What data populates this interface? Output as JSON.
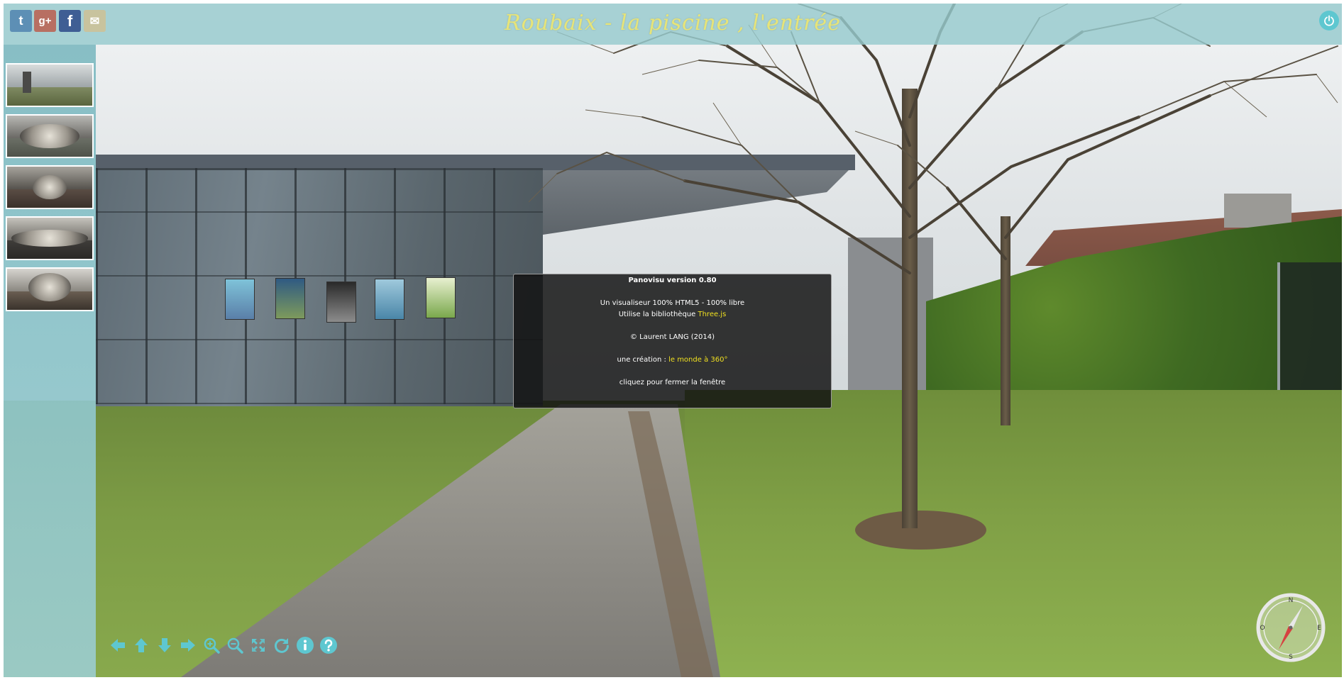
{
  "title": "Roubaix - la piscine , l'entrée",
  "social": {
    "twitter": {
      "icon": "twitter-icon",
      "glyph": "t",
      "color": "#5d8fb5"
    },
    "googleplus": {
      "icon": "google-plus-icon",
      "glyph": "g+",
      "color": "#b86f62"
    },
    "facebook": {
      "icon": "facebook-icon",
      "glyph": "f",
      "color": "#3f5e94"
    },
    "email": {
      "icon": "mail-icon",
      "glyph": "✉",
      "color": "#c8c39e"
    }
  },
  "thumbnails": [
    {
      "name": "pano-1"
    },
    {
      "name": "pano-2"
    },
    {
      "name": "pano-3"
    },
    {
      "name": "pano-4"
    },
    {
      "name": "pano-5"
    }
  ],
  "popup": {
    "heading": "Panovisu version 0.80",
    "line1": "Un visualiseur 100% HTML5 - 100% libre",
    "line2_prefix": "Utilise la bibliothèque ",
    "line2_link": "Three.js",
    "copyright": "© Laurent LANG (2014)",
    "creation_prefix": "une création : ",
    "creation_link": "le monde à 360°",
    "close_hint": "cliquez pour fermer la fenêtre"
  },
  "toolbar": [
    {
      "icon": "arrow-left-icon"
    },
    {
      "icon": "arrow-up-icon"
    },
    {
      "icon": "arrow-down-icon"
    },
    {
      "icon": "arrow-right-icon"
    },
    {
      "icon": "zoom-in-icon"
    },
    {
      "icon": "zoom-out-icon"
    },
    {
      "icon": "fullscreen-icon"
    },
    {
      "icon": "rotate-icon"
    },
    {
      "icon": "info-icon"
    },
    {
      "icon": "help-icon"
    }
  ],
  "compass": {
    "north": "N",
    "east": "E",
    "south": "S",
    "west": "O"
  },
  "colors": {
    "accent": "#5ec7d0",
    "title": "#e7e478",
    "link": "#f0e020",
    "toolbar_icon": "#5ec7d0"
  }
}
